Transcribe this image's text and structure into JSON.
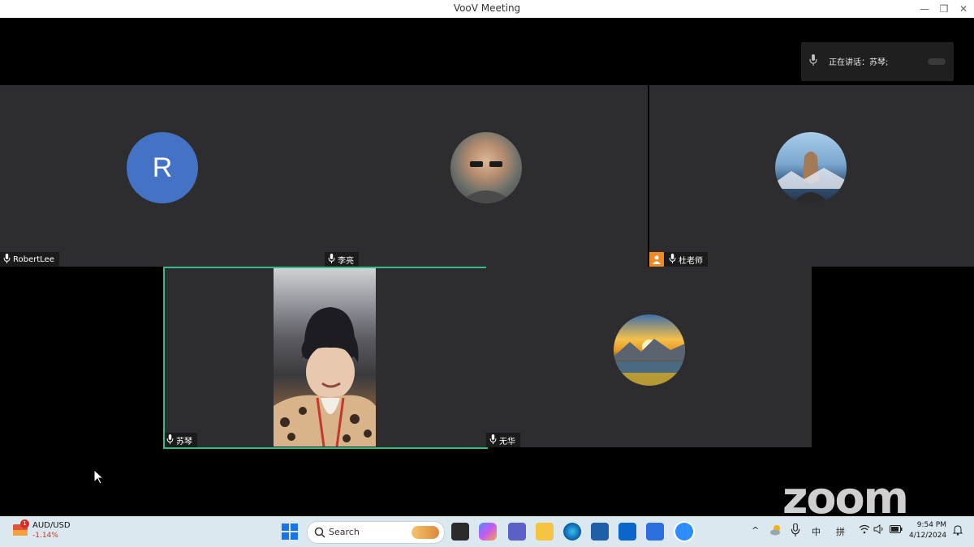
{
  "window": {
    "title": "VooV Meeting"
  },
  "speaking": {
    "text": "正在讲话：苏琴;"
  },
  "participants": [
    {
      "name": "RobertLee",
      "initial": "R"
    },
    {
      "name": "李亮"
    },
    {
      "name": "杜老师"
    },
    {
      "name": "苏琴"
    },
    {
      "name": "无华"
    }
  ],
  "watermark": {
    "text": "zoom"
  },
  "taskbar": {
    "stock": {
      "symbol": "AUD/USD",
      "change": "-1.14%",
      "badge": "1"
    },
    "search_placeholder": "Search",
    "ime_lang": "中",
    "ime_mode": "拼",
    "time": "9:54 PM",
    "date": "4/12/2024"
  },
  "colors": {
    "active_speaker": "#2fbf86",
    "tile_bg": "#2d2d30",
    "avatar_r": "#4472c4",
    "host_badge": "#f08a24"
  }
}
